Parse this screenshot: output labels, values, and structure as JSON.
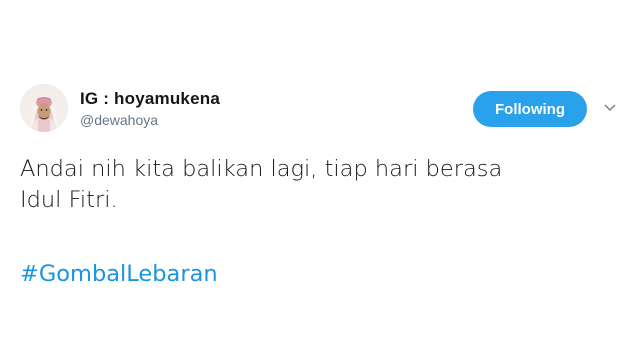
{
  "user": {
    "display_name": "IG : hoyamukena",
    "handle": "@dewahoya"
  },
  "follow_button": {
    "label": "Following"
  },
  "tweet": {
    "line1": "Andai nih kita balikan lagi, tiap hari berasa",
    "line2": "Idul Fitri.",
    "hashtag": "#GombalLebaran"
  },
  "colors": {
    "accent": "#1b95e0",
    "button_bg": "#2aa1eb",
    "handle": "#657786",
    "text": "#14171a"
  },
  "icons": {
    "avatar": "profile-photo",
    "menu": "chevron-down-icon"
  }
}
